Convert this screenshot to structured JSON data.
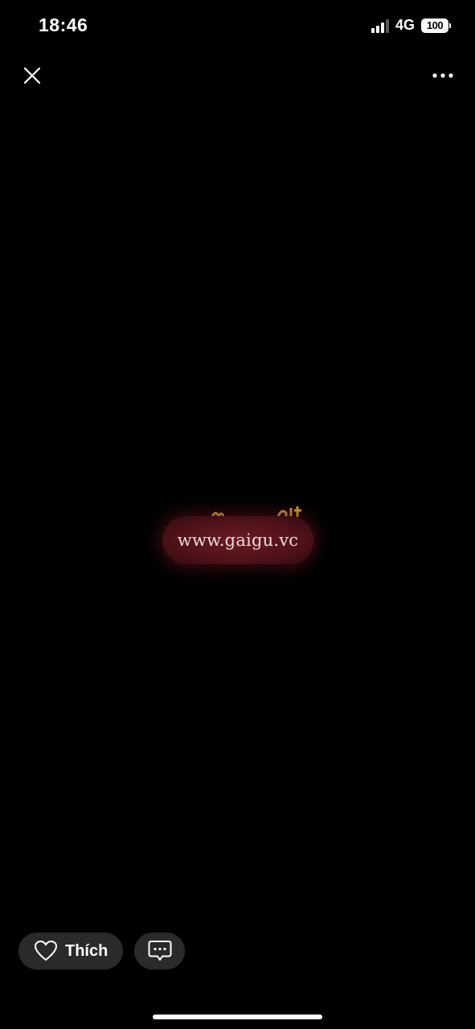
{
  "status_bar": {
    "time": "18:46",
    "network": "4G",
    "battery_level": "100",
    "signal_bars_active": 3,
    "signal_bars_total": 4
  },
  "toolbar": {
    "close_icon": "close-icon",
    "more_icon": "more-horizontal-icon"
  },
  "media": {
    "watermark_text": "www.gaigu.vc",
    "watermark_color": "#5a141c",
    "accent_fragment_color": "#d4a630"
  },
  "actions": {
    "like_label": "Thích",
    "like_icon": "heart-outline-icon",
    "comment_icon": "comment-bubble-icon",
    "button_background": "#2a2a2a"
  }
}
